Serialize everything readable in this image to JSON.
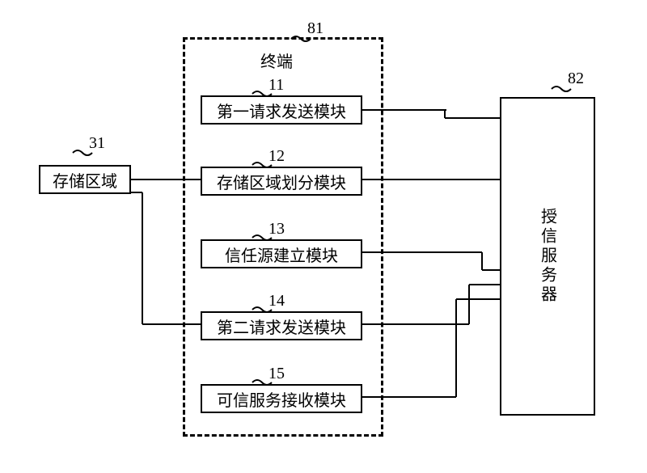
{
  "terminal": {
    "label": "终端",
    "number": "81"
  },
  "server": {
    "label": "授信服务器",
    "number": "82"
  },
  "storage": {
    "label": "存储区域",
    "number": "31"
  },
  "modules": {
    "m11": {
      "label": "第一请求发送模块",
      "number": "11"
    },
    "m12": {
      "label": "存储区域划分模块",
      "number": "12"
    },
    "m13": {
      "label": "信任源建立模块",
      "number": "13"
    },
    "m14": {
      "label": "第二请求发送模块",
      "number": "14"
    },
    "m15": {
      "label": "可信服务接收模块",
      "number": "15"
    }
  }
}
